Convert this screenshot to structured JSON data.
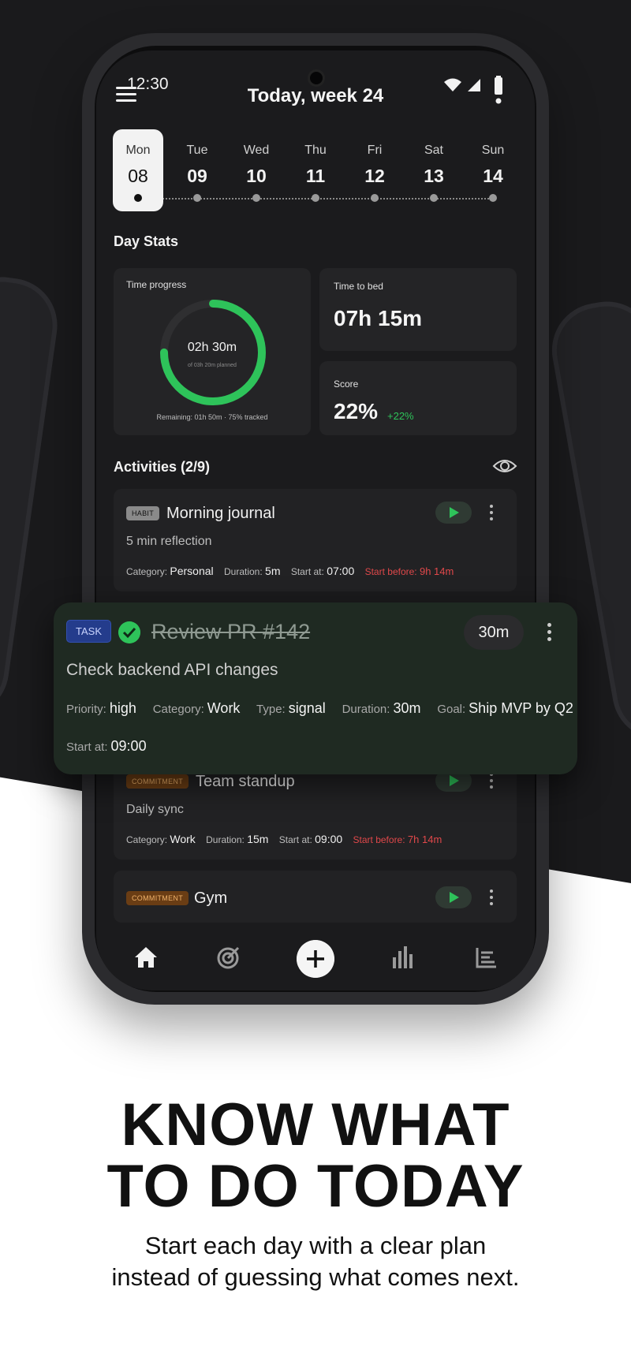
{
  "status": {
    "time": "12:30"
  },
  "header": {
    "title": "Today, week 24"
  },
  "week": [
    {
      "name": "Mon",
      "num": "08"
    },
    {
      "name": "Tue",
      "num": "09"
    },
    {
      "name": "Wed",
      "num": "10"
    },
    {
      "name": "Thu",
      "num": "11"
    },
    {
      "name": "Fri",
      "num": "12"
    },
    {
      "name": "Sat",
      "num": "13"
    },
    {
      "name": "Sun",
      "num": "14"
    }
  ],
  "day_stats": {
    "title": "Day Stats",
    "time_progress": {
      "label": "Time progress",
      "value": "02h 30m",
      "planned": "of 03h 20m planned",
      "remaining": "Remaining: 01h 50m · 75% tracked",
      "progress_fraction": 0.75
    },
    "time_to_bed": {
      "label": "Time to bed",
      "value": "07h 15m"
    },
    "score": {
      "label": "Score",
      "value": "22%",
      "delta": "+22%"
    }
  },
  "activities": {
    "title": "Activities (2/9)",
    "morning_journal": {
      "badge": "HABIT",
      "title": "Morning journal",
      "subtitle": "5 min reflection",
      "category_label": "Category:",
      "category": "Personal",
      "duration_label": "Duration:",
      "duration": "5m",
      "start_label": "Start at:",
      "start": "07:00",
      "before_label": "Start before:",
      "before": "9h 14m"
    },
    "task": {
      "badge": "TASK",
      "title": "Review PR #142",
      "duration": "30m",
      "subtitle": "Check backend API changes",
      "priority_label": "Priority:",
      "priority": "high",
      "category_label": "Category:",
      "category": "Work",
      "type_label": "Type:",
      "type": "signal",
      "duration_label": "Duration:",
      "duration_value": "30m",
      "goal_label": "Goal:",
      "goal": "Ship MVP by Q2",
      "start_label": "Start at:",
      "start": "09:00"
    },
    "team_standup": {
      "badge": "COMMITMENT",
      "title": "Team standup",
      "subtitle": "Daily sync",
      "category_label": "Category:",
      "category": "Work",
      "duration_label": "Duration:",
      "duration": "15m",
      "start_label": "Start at:",
      "start": "09:00",
      "before_label": "Start before:",
      "before": "7h 14m"
    },
    "gym": {
      "badge": "COMMITMENT",
      "title": "Gym"
    }
  },
  "marketing": {
    "headline_1": "KNOW WHAT",
    "headline_2": "TO DO TODAY",
    "sub_1": "Start each day with a clear plan",
    "sub_2": "instead of guessing what comes next."
  },
  "colors": {
    "accent_green": "#2ec35a",
    "alert_red": "#e0484a",
    "task_blue": "#243c8c",
    "commitment_orange": "#6a3d14"
  }
}
